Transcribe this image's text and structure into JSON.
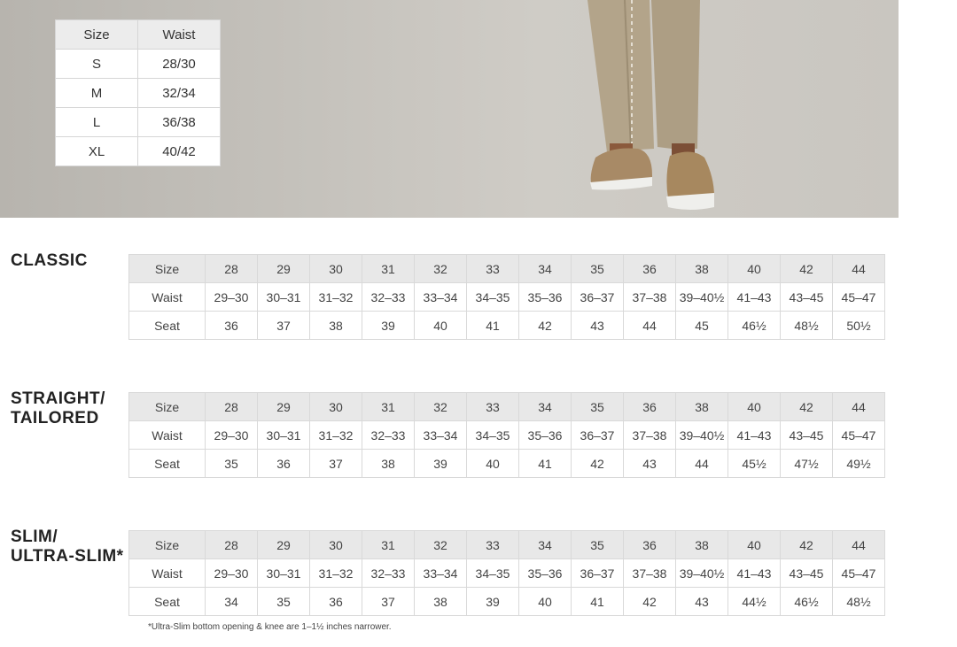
{
  "top_table": {
    "headers": [
      "Size",
      "Waist"
    ],
    "rows": [
      [
        "S",
        "28/30"
      ],
      [
        "M",
        "32/34"
      ],
      [
        "L",
        "36/38"
      ],
      [
        "XL",
        "40/42"
      ]
    ]
  },
  "classic": {
    "title": "CLASSIC",
    "sizes": [
      "Size",
      "28",
      "29",
      "30",
      "31",
      "32",
      "33",
      "34",
      "35",
      "36",
      "38",
      "40",
      "42",
      "44"
    ],
    "waist": [
      "Waist",
      "29–30",
      "30–31",
      "31–32",
      "32–33",
      "33–34",
      "34–35",
      "35–36",
      "36–37",
      "37–38",
      "39–40½",
      "41–43",
      "43–45",
      "45–47"
    ],
    "seat": [
      "Seat",
      "36",
      "37",
      "38",
      "39",
      "40",
      "41",
      "42",
      "43",
      "44",
      "45",
      "46½",
      "48½",
      "50½"
    ]
  },
  "straight": {
    "title_line1": "STRAIGHT/",
    "title_line2": "TAILORED",
    "sizes": [
      "Size",
      "28",
      "29",
      "30",
      "31",
      "32",
      "33",
      "34",
      "35",
      "36",
      "38",
      "40",
      "42",
      "44"
    ],
    "waist": [
      "Waist",
      "29–30",
      "30–31",
      "31–32",
      "32–33",
      "33–34",
      "34–35",
      "35–36",
      "36–37",
      "37–38",
      "39–40½",
      "41–43",
      "43–45",
      "45–47"
    ],
    "seat": [
      "Seat",
      "35",
      "36",
      "37",
      "38",
      "39",
      "40",
      "41",
      "42",
      "43",
      "44",
      "45½",
      "47½",
      "49½"
    ]
  },
  "slim": {
    "title_line1": "SLIM/",
    "title_line2": "ULTRA-SLIM*",
    "sizes": [
      "Size",
      "28",
      "29",
      "30",
      "31",
      "32",
      "33",
      "34",
      "35",
      "36",
      "38",
      "40",
      "42",
      "44"
    ],
    "waist": [
      "Waist",
      "29–30",
      "30–31",
      "31–32",
      "32–33",
      "33–34",
      "34–35",
      "35–36",
      "36–37",
      "37–38",
      "39–40½",
      "41–43",
      "43–45",
      "45–47"
    ],
    "seat": [
      "Seat",
      "34",
      "35",
      "36",
      "37",
      "38",
      "39",
      "40",
      "41",
      "42",
      "43",
      "44½",
      "46½",
      "48½"
    ]
  },
  "footnote": "*Ultra-Slim bottom opening & knee are 1–1½ inches narrower."
}
